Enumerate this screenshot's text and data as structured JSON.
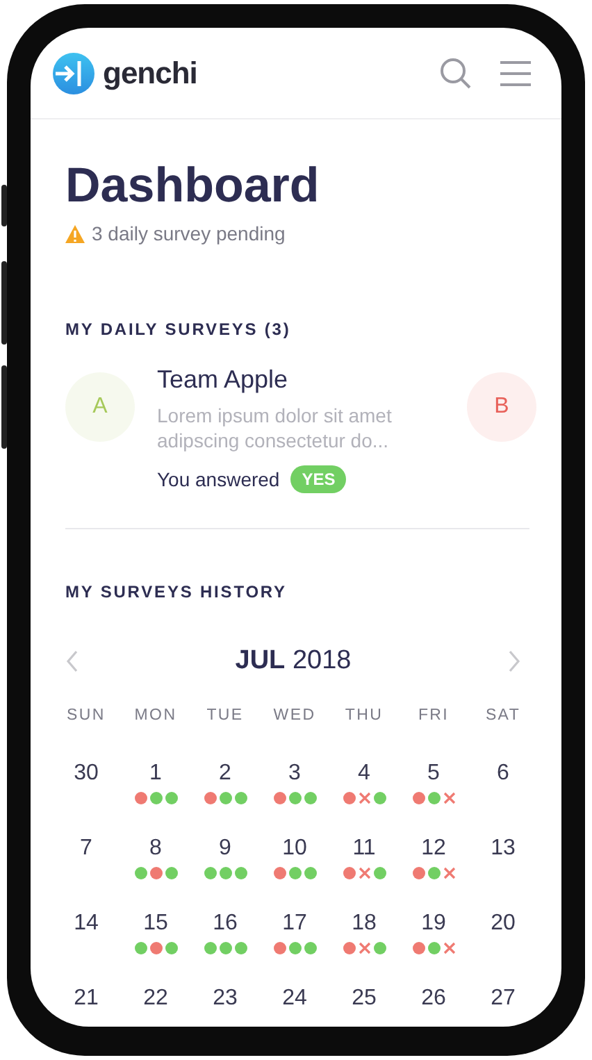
{
  "app": {
    "name": "genchi"
  },
  "page": {
    "title": "Dashboard",
    "notice": "3 daily survey pending"
  },
  "daily_surveys": {
    "heading": "MY DAILY SURVEYS (3)",
    "cards": [
      {
        "initial": "A",
        "color": "#a6c95a",
        "title": "Team Apple",
        "description": "Lorem ipsum dolor sit amet adipscing consectetur do...",
        "answer_label": "You answered",
        "answer": "YES"
      },
      {
        "initial": "B",
        "color": "#e8615a"
      }
    ]
  },
  "history": {
    "heading": "MY SURVEYS HISTORY",
    "month": "JUL",
    "year": "2018",
    "weekdays": [
      "SUN",
      "MON",
      "TUE",
      "WED",
      "THU",
      "FRI",
      "SAT"
    ],
    "weeks": [
      [
        {
          "day": "30"
        },
        {
          "day": "1",
          "marks": [
            {
              "kind": "dot",
              "color": "#ef7a72"
            },
            {
              "kind": "dot",
              "color": "#72cf63"
            },
            {
              "kind": "dot",
              "color": "#72cf63"
            }
          ]
        },
        {
          "day": "2",
          "marks": [
            {
              "kind": "dot",
              "color": "#ef7a72"
            },
            {
              "kind": "dot",
              "color": "#72cf63"
            },
            {
              "kind": "dot",
              "color": "#72cf63"
            }
          ]
        },
        {
          "day": "3",
          "marks": [
            {
              "kind": "dot",
              "color": "#ef7a72"
            },
            {
              "kind": "dot",
              "color": "#72cf63"
            },
            {
              "kind": "dot",
              "color": "#72cf63"
            }
          ]
        },
        {
          "day": "4",
          "marks": [
            {
              "kind": "dot",
              "color": "#ef7a72"
            },
            {
              "kind": "cross",
              "color": "#ef7a72"
            },
            {
              "kind": "dot",
              "color": "#72cf63"
            }
          ]
        },
        {
          "day": "5",
          "marks": [
            {
              "kind": "dot",
              "color": "#ef7a72"
            },
            {
              "kind": "dot",
              "color": "#72cf63"
            },
            {
              "kind": "cross",
              "color": "#ef7a72"
            }
          ]
        },
        {
          "day": "6"
        }
      ],
      [
        {
          "day": "7"
        },
        {
          "day": "8",
          "marks": [
            {
              "kind": "dot",
              "color": "#72cf63"
            },
            {
              "kind": "dot",
              "color": "#ef7a72"
            },
            {
              "kind": "dot",
              "color": "#72cf63"
            }
          ]
        },
        {
          "day": "9",
          "marks": [
            {
              "kind": "dot",
              "color": "#72cf63"
            },
            {
              "kind": "dot",
              "color": "#72cf63"
            },
            {
              "kind": "dot",
              "color": "#72cf63"
            }
          ]
        },
        {
          "day": "10",
          "marks": [
            {
              "kind": "dot",
              "color": "#ef7a72"
            },
            {
              "kind": "dot",
              "color": "#72cf63"
            },
            {
              "kind": "dot",
              "color": "#72cf63"
            }
          ]
        },
        {
          "day": "11",
          "marks": [
            {
              "kind": "dot",
              "color": "#ef7a72"
            },
            {
              "kind": "cross",
              "color": "#ef7a72"
            },
            {
              "kind": "dot",
              "color": "#72cf63"
            }
          ]
        },
        {
          "day": "12",
          "marks": [
            {
              "kind": "dot",
              "color": "#ef7a72"
            },
            {
              "kind": "dot",
              "color": "#72cf63"
            },
            {
              "kind": "cross",
              "color": "#ef7a72"
            }
          ]
        },
        {
          "day": "13"
        }
      ],
      [
        {
          "day": "14"
        },
        {
          "day": "15",
          "marks": [
            {
              "kind": "dot",
              "color": "#72cf63"
            },
            {
              "kind": "dot",
              "color": "#ef7a72"
            },
            {
              "kind": "dot",
              "color": "#72cf63"
            }
          ]
        },
        {
          "day": "16",
          "marks": [
            {
              "kind": "dot",
              "color": "#72cf63"
            },
            {
              "kind": "dot",
              "color": "#72cf63"
            },
            {
              "kind": "dot",
              "color": "#72cf63"
            }
          ]
        },
        {
          "day": "17",
          "marks": [
            {
              "kind": "dot",
              "color": "#ef7a72"
            },
            {
              "kind": "dot",
              "color": "#72cf63"
            },
            {
              "kind": "dot",
              "color": "#72cf63"
            }
          ]
        },
        {
          "day": "18",
          "marks": [
            {
              "kind": "dot",
              "color": "#ef7a72"
            },
            {
              "kind": "cross",
              "color": "#ef7a72"
            },
            {
              "kind": "dot",
              "color": "#72cf63"
            }
          ]
        },
        {
          "day": "19",
          "marks": [
            {
              "kind": "dot",
              "color": "#ef7a72"
            },
            {
              "kind": "dot",
              "color": "#72cf63"
            },
            {
              "kind": "cross",
              "color": "#ef7a72"
            }
          ]
        },
        {
          "day": "20"
        }
      ],
      [
        {
          "day": "21"
        },
        {
          "day": "22"
        },
        {
          "day": "23"
        },
        {
          "day": "24"
        },
        {
          "day": "25"
        },
        {
          "day": "26"
        },
        {
          "day": "27"
        }
      ]
    ]
  }
}
